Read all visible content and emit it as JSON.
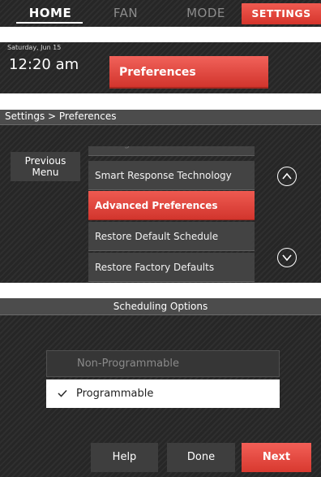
{
  "nav": {
    "home": "HOME",
    "fan": "FAN",
    "mode": "MODE",
    "settings": "SETTINGS"
  },
  "status": {
    "date": "Saturday, Jun 15",
    "time": "12:20 am",
    "preferences_button": "Preferences"
  },
  "settings_menu": {
    "breadcrumb": "Settings > Preferences",
    "previous_menu_line1": "Previous",
    "previous_menu_line2": "Menu",
    "items": [
      {
        "label": "Backlight",
        "state": "partial"
      },
      {
        "label": "Smart Response Technology",
        "state": "normal"
      },
      {
        "label": "Advanced Preferences",
        "state": "selected"
      },
      {
        "label": "Restore Default Schedule",
        "state": "normal"
      },
      {
        "label": "Restore Factory Defaults",
        "state": "normal"
      }
    ],
    "icons": {
      "up": "chevron-up-icon",
      "down": "chevron-down-icon"
    }
  },
  "scheduling": {
    "title": "Scheduling Options",
    "options": [
      {
        "label": "Non-Programmable",
        "selected": false
      },
      {
        "label": "Programmable",
        "selected": true
      }
    ],
    "check_glyph": "✓",
    "buttons": {
      "help": "Help",
      "done": "Done",
      "next": "Next"
    }
  },
  "colors": {
    "accent": "#e2463d",
    "background": "#262626",
    "title_bar": "#4c4c4c"
  }
}
